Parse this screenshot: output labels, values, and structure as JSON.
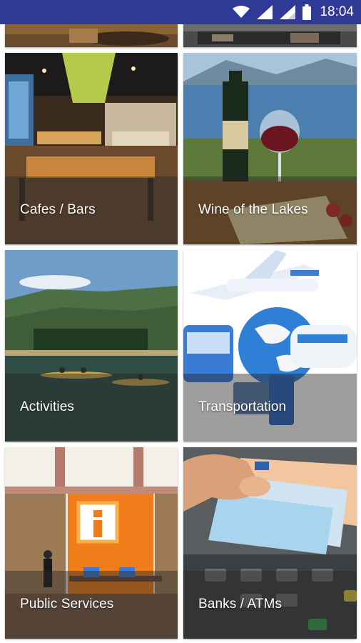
{
  "status_bar": {
    "time": "18:04",
    "icons": [
      "wifi-icon",
      "signal-icon",
      "signal-icon",
      "battery-icon"
    ]
  },
  "tiles": [
    {
      "label": "Cafes / Bars",
      "icon": "cafe-photo"
    },
    {
      "label": "Wine of the Lakes",
      "icon": "wine-photo"
    },
    {
      "label": "Activities",
      "icon": "lake-kayak-photo"
    },
    {
      "label": "Transportation",
      "icon": "transport-photo"
    },
    {
      "label": "Public Services",
      "icon": "info-center-photo"
    },
    {
      "label": "Banks / ATMs",
      "icon": "atm-money-photo"
    }
  ],
  "colors": {
    "status_bar": "#2e3a96",
    "caption_band": "rgba(40,40,40,0.45)"
  }
}
